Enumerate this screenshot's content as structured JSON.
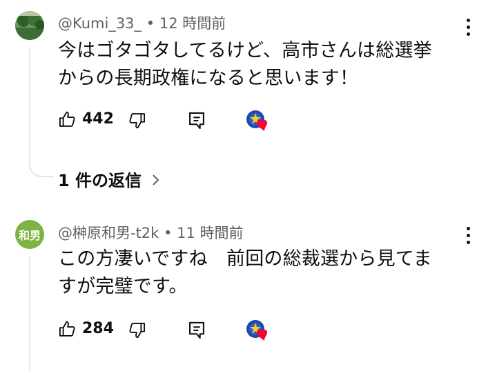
{
  "comments": [
    {
      "author": "@Kumi_33_",
      "separator": "•",
      "time": "12 時間前",
      "lines": [
        "今はゴタゴタしてるけど、高市さんは総選挙",
        "からの長期政権になると思います！"
      ],
      "likes": "442",
      "replies_label": "1 件の返信",
      "avatar_icon": "nature-photo-avatar"
    },
    {
      "author": "@榊原和男-t2k",
      "separator": "•",
      "time": "11 時間前",
      "lines": [
        "この方凄いですね　前回の総裁選から見てま",
        "すが完璧です。"
      ],
      "likes": "284",
      "avatar_text": "和男"
    }
  ],
  "icons": {
    "like": "thumbs-up-icon",
    "dislike": "thumbs-down-icon",
    "reply": "reply-icon",
    "more": "more-vertical-icon",
    "creator_heart": "creator-heart-icon",
    "expand": "chevron-right-icon"
  },
  "colors": {
    "heart": "#ff0033",
    "meta": "#606060",
    "line": "#e5e5e5"
  }
}
